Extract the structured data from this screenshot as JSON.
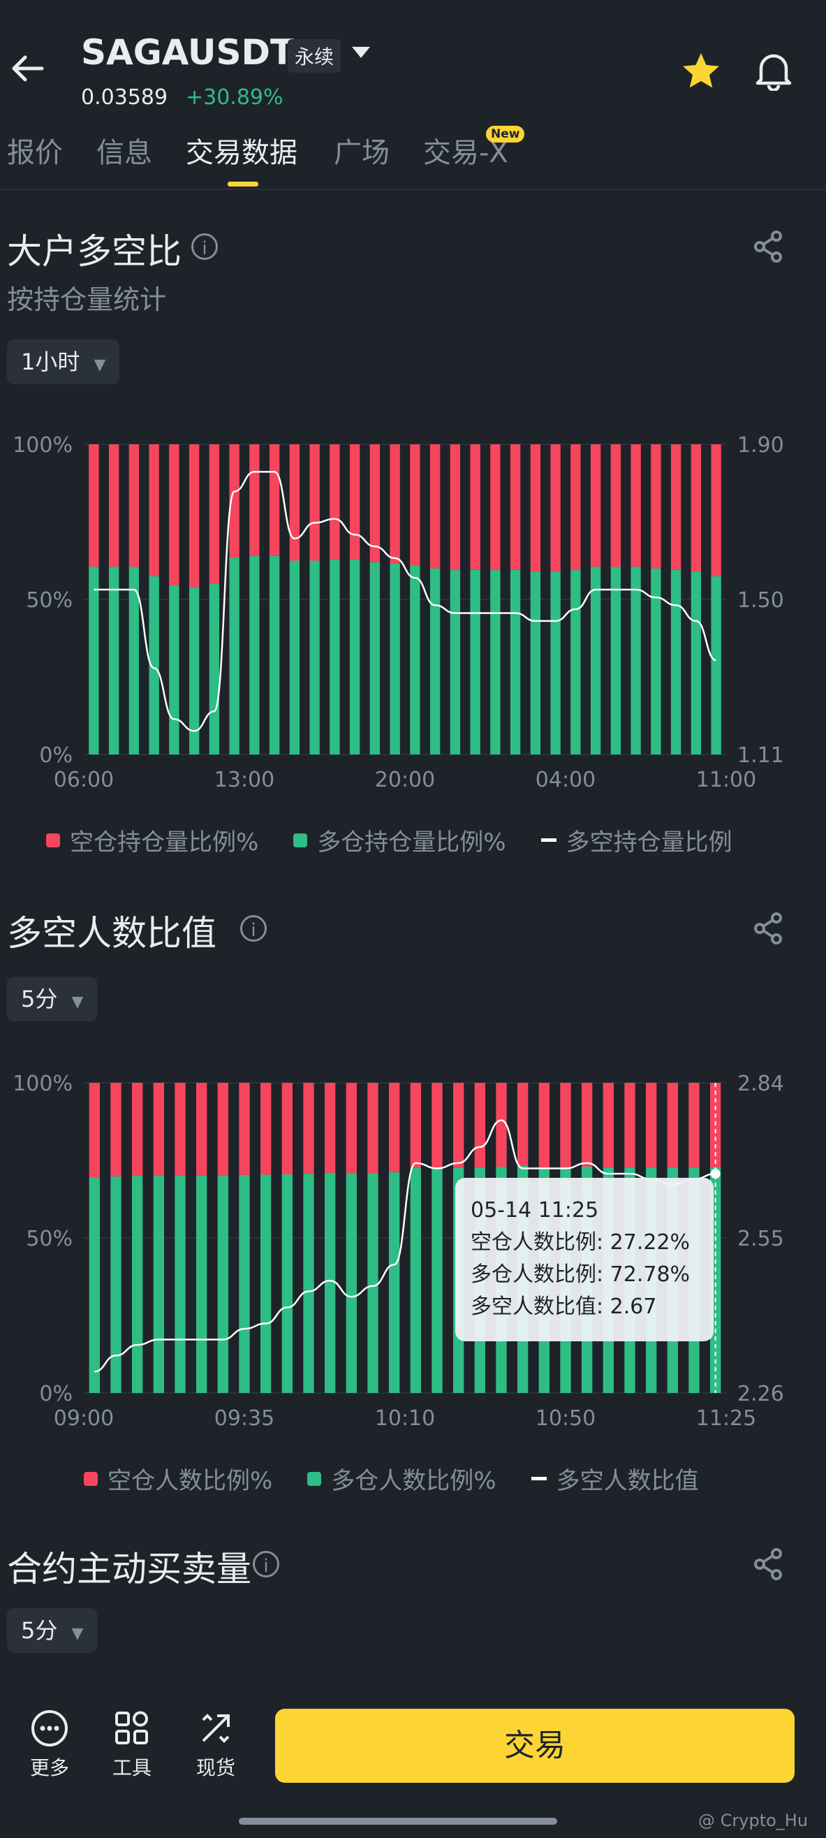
{
  "header": {
    "symbol": "SAGAUSDT",
    "contract_type": "永续",
    "price": "0.03589",
    "change": "+30.89%",
    "icons": {
      "back": "back-arrow-icon",
      "star": "star-icon",
      "bell": "bell-icon",
      "dropdown": "caret-down-icon"
    }
  },
  "tabs": [
    {
      "label": "报价"
    },
    {
      "label": "信息"
    },
    {
      "label": "交易数据",
      "active": true
    },
    {
      "label": "广场"
    },
    {
      "label": "交易-X",
      "badge": "New"
    }
  ],
  "section1": {
    "title": "大户多空比",
    "subtitle": "按持仓量统计",
    "interval": "1小时",
    "legend": [
      "空仓持仓量比例%",
      "多仓持仓量比例%",
      "多空持仓量比例"
    ]
  },
  "section2": {
    "title": "多空人数比值",
    "interval": "5分",
    "legend": [
      "空仓人数比例%",
      "多仓人数比例%",
      "多空人数比值"
    ],
    "tooltip": {
      "time": "05-14 11:25",
      "short_line": "空仓人数比例: 27.22%",
      "long_line": "多仓人数比例: 72.78%",
      "ratio_line": "多空人数比值: 2.67"
    }
  },
  "section3": {
    "title": "合约主动买卖量",
    "interval": "5分"
  },
  "bottom_bar": {
    "more": "更多",
    "tools": "工具",
    "spot": "现货",
    "trade": "交易",
    "watermark": "@ Crypto_Hu"
  },
  "colors": {
    "short": "#f6465d",
    "long": "#2ebd85",
    "line": "#ffffff",
    "accent": "#fcd535"
  },
  "chart_data": [
    {
      "type": "bar",
      "stacked": true,
      "x_tick_labels": [
        "06:00",
        "13:00",
        "20:00",
        "04:00",
        "11:00"
      ],
      "y_left_ticks": [
        "0%",
        "50%",
        "100%"
      ],
      "y_right_ticks": [
        "1.11",
        "1.50",
        "1.90"
      ],
      "ylim_left": [
        0,
        100
      ],
      "ylim_right": [
        1.11,
        1.9
      ],
      "series": [
        {
          "name": "多仓持仓量比例%",
          "values": [
            60.5,
            60.5,
            60.5,
            57.5,
            54.5,
            54,
            55,
            63.5,
            64,
            64,
            62.5,
            62.5,
            63,
            63,
            62,
            61.5,
            61,
            60,
            59.5,
            59.5,
            59.5,
            59.5,
            59,
            59,
            59.5,
            60.5,
            60.5,
            60.5,
            60,
            59.5,
            59,
            57.5
          ]
        },
        {
          "name": "空仓持仓量比例%",
          "values": [
            39.5,
            39.5,
            39.5,
            42.5,
            45.5,
            46,
            45,
            36.5,
            36,
            36,
            37.5,
            37.5,
            37,
            37,
            38,
            38.5,
            39,
            40,
            40.5,
            40.5,
            40.5,
            40.5,
            41,
            41,
            40.5,
            39.5,
            39.5,
            39.5,
            40,
            40.5,
            41,
            42.5
          ]
        },
        {
          "name": "多空持仓量比例",
          "values": [
            1.53,
            1.53,
            1.53,
            1.33,
            1.2,
            1.17,
            1.22,
            1.78,
            1.83,
            1.83,
            1.66,
            1.7,
            1.71,
            1.67,
            1.64,
            1.61,
            1.56,
            1.49,
            1.47,
            1.47,
            1.47,
            1.47,
            1.45,
            1.45,
            1.48,
            1.53,
            1.53,
            1.53,
            1.51,
            1.49,
            1.45,
            1.35
          ]
        }
      ]
    },
    {
      "type": "bar",
      "stacked": true,
      "x_tick_labels": [
        "09:00",
        "09:35",
        "10:10",
        "10:50",
        "11:25"
      ],
      "y_left_ticks": [
        "0%",
        "50%",
        "100%"
      ],
      "y_right_ticks": [
        "2.26",
        "2.55",
        "2.84"
      ],
      "ylim_left": [
        0,
        100
      ],
      "ylim_right": [
        2.26,
        2.84
      ],
      "series": [
        {
          "name": "多仓人数比例%",
          "values": [
            69.5,
            69.8,
            70,
            70.1,
            70.1,
            70.1,
            70.1,
            70.3,
            70.4,
            70.5,
            70.7,
            71,
            70.9,
            70.9,
            71.2,
            72.5,
            72.6,
            72.6,
            72.7,
            72.9,
            73.3,
            72.7,
            72.8,
            73,
            72.8,
            72.8,
            72.7,
            72.7,
            72.7,
            72.78
          ]
        },
        {
          "name": "空仓人数比例%",
          "values": [
            30.5,
            30.2,
            30,
            29.9,
            29.9,
            29.9,
            29.9,
            29.7,
            29.6,
            29.5,
            29.3,
            29,
            29.1,
            29.1,
            28.8,
            27.5,
            27.4,
            27.4,
            27.3,
            27.1,
            26.7,
            27.3,
            27.2,
            27,
            27.2,
            27.2,
            27.3,
            27.3,
            27.3,
            27.22
          ]
        },
        {
          "name": "多空人数比值",
          "values": [
            2.3,
            2.33,
            2.35,
            2.36,
            2.36,
            2.36,
            2.36,
            2.38,
            2.39,
            2.42,
            2.45,
            2.47,
            2.44,
            2.46,
            2.5,
            2.69,
            2.68,
            2.69,
            2.72,
            2.77,
            2.68,
            2.68,
            2.68,
            2.69,
            2.67,
            2.67,
            2.66,
            2.65,
            2.66,
            2.67
          ]
        }
      ]
    }
  ]
}
